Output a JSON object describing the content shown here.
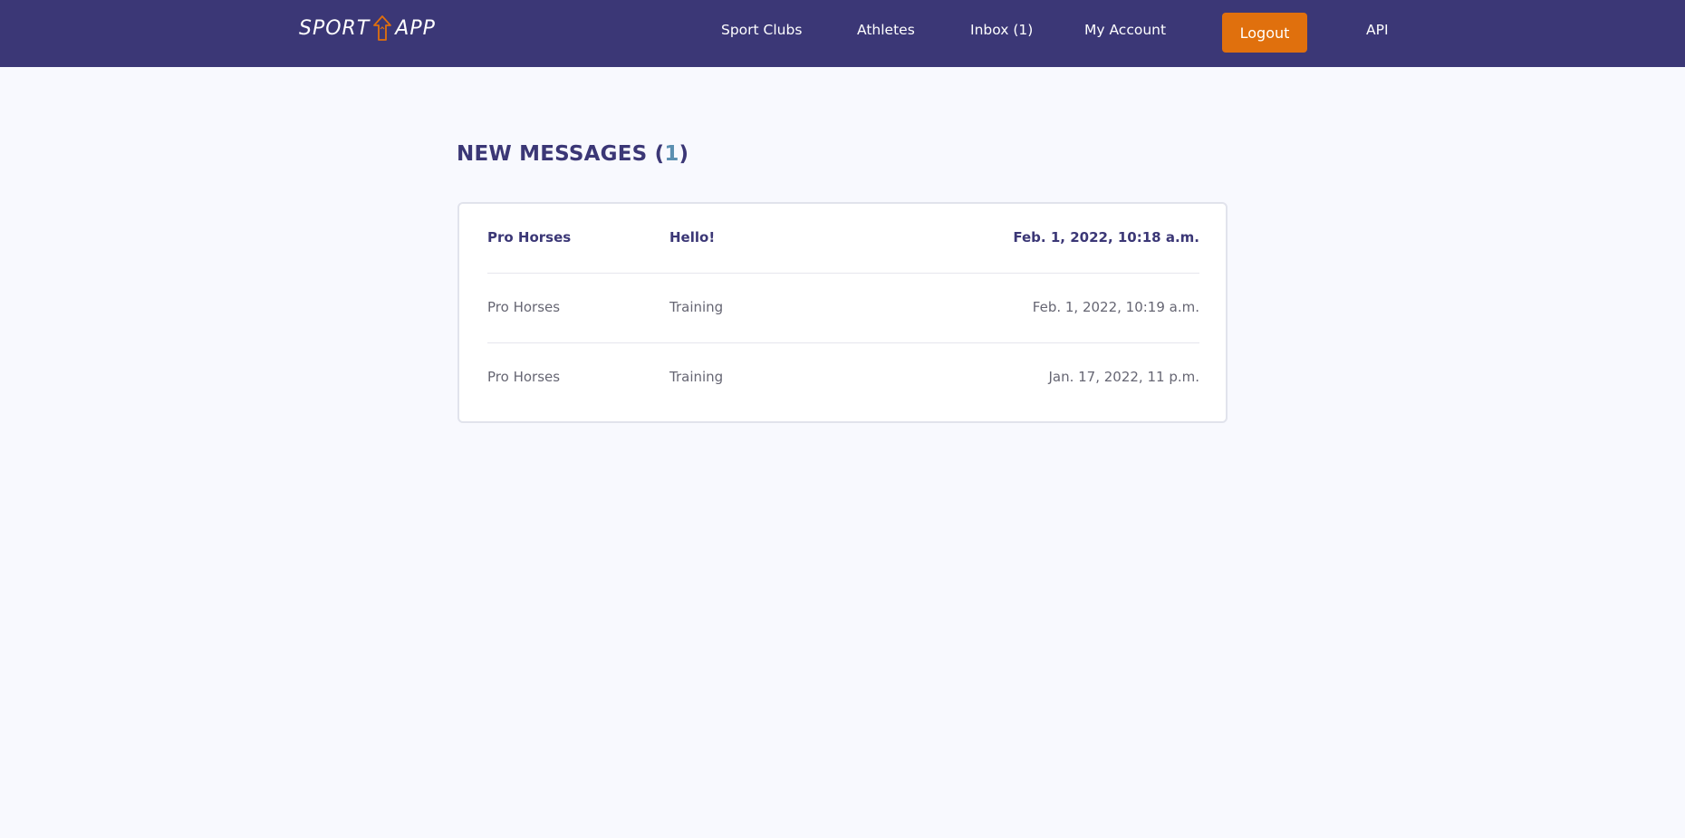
{
  "app": {
    "logo_left": "SPORT",
    "logo_right": "APP",
    "brand_color": "#3b3776",
    "accent_color": "#e0700d"
  },
  "nav": {
    "sport_clubs": "Sport Clubs",
    "athletes": "Athletes",
    "inbox": "Inbox (1)",
    "my_account": "My Account",
    "logout": "Logout",
    "api": "API"
  },
  "main": {
    "title_prefix": "NEW MESSAGES (",
    "title_count": "1",
    "title_suffix": ")",
    "messages": [
      {
        "sender": "Pro Horses",
        "subject": "Hello!",
        "date": "Feb. 1, 2022, 10:18 a.m.",
        "unread": true
      },
      {
        "sender": "Pro Horses",
        "subject": "Training",
        "date": "Feb. 1, 2022, 10:19 a.m.",
        "unread": false
      },
      {
        "sender": "Pro Horses",
        "subject": "Training",
        "date": "Jan. 17, 2022, 11 p.m.",
        "unread": false
      }
    ]
  }
}
